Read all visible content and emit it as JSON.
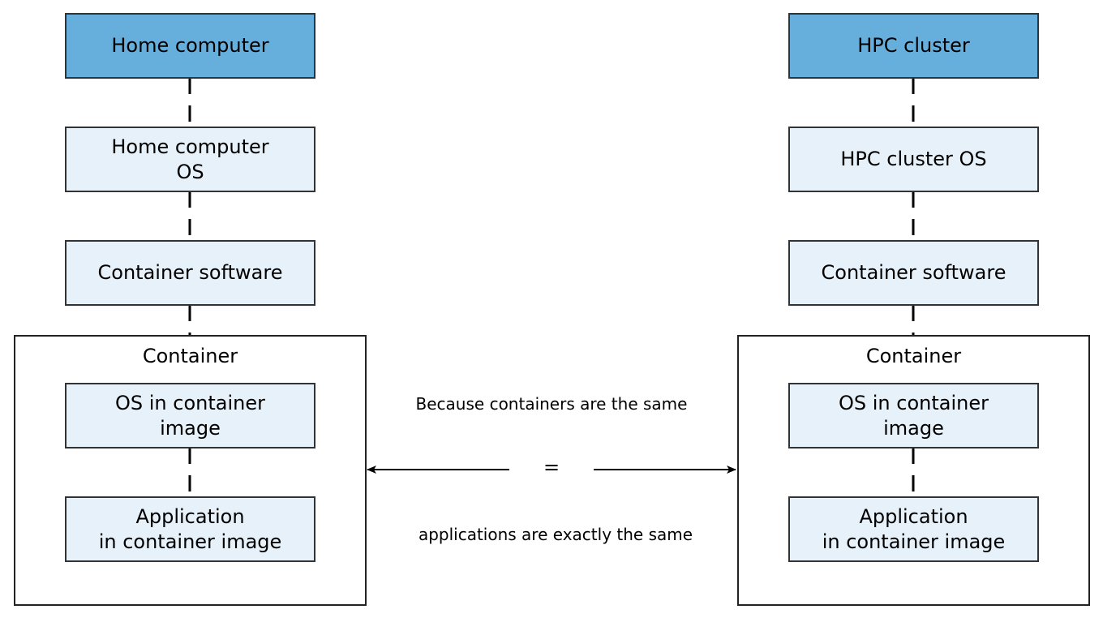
{
  "left_stack": {
    "host": "Home computer",
    "os": "Home computer\nOS",
    "software": "Container software",
    "container_title": "Container",
    "image_os": "OS in container\nimage",
    "application": "Application\nin container image"
  },
  "right_stack": {
    "host": "HPC cluster",
    "os": "HPC cluster OS",
    "software": "Container software",
    "container_title": "Container",
    "image_os": "OS in container\nimage",
    "application": "Application\nin container image"
  },
  "comparison": {
    "top_text": "Because containers are the same",
    "symbol": "=",
    "bottom_text": "applications are exactly the same"
  },
  "colors": {
    "host_fill": "#66aedc",
    "layer_fill": "#e7f1fa",
    "stroke": "#333333"
  }
}
